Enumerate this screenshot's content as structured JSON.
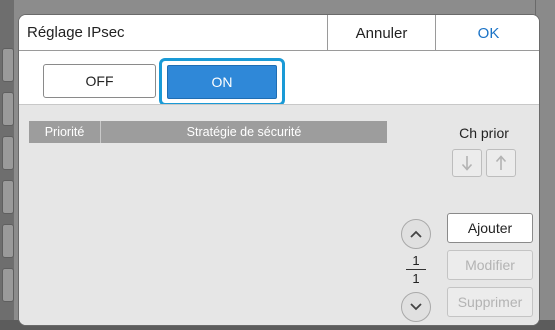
{
  "dialog": {
    "title": "Réglage IPsec",
    "cancel_label": "Annuler",
    "ok_label": "OK"
  },
  "toggle": {
    "off_label": "OFF",
    "on_label": "ON",
    "selected": "ON"
  },
  "table": {
    "columns": [
      "Priorité",
      "Stratégie de sécurité"
    ],
    "rows": []
  },
  "priority": {
    "label": "Ch prior",
    "down_icon": "arrow-down-icon",
    "up_icon": "arrow-up-icon"
  },
  "pagination": {
    "current": "1",
    "total": "1"
  },
  "actions": {
    "add_label": "Ajouter",
    "modify_label": "Modifier",
    "delete_label": "Supprimer"
  },
  "colors": {
    "accent": "#2f88d8",
    "focus_ring": "#1a9ad6",
    "ok_text": "#1b73c6"
  }
}
